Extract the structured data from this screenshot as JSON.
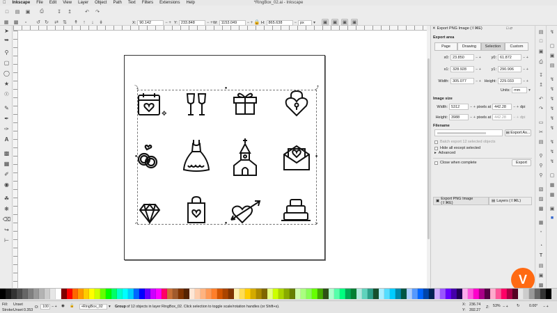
{
  "menubar": {
    "app": "Inkscape",
    "items": [
      "File",
      "Edit",
      "View",
      "Layer",
      "Object",
      "Path",
      "Text",
      "Filters",
      "Extensions",
      "Help"
    ],
    "window_title": "*RingBox_02.ai - Inkscape"
  },
  "toolbar": {
    "x": {
      "label": "X:",
      "value": "90.142"
    },
    "y": {
      "label": "Y:",
      "value": "233.848"
    },
    "w": {
      "label": "W:",
      "value": "1153.049"
    },
    "h": {
      "label": "H:",
      "value": "865.638"
    },
    "unit": "px"
  },
  "panel": {
    "title": "Export PNG Image (⇧⌘E)",
    "export_area_label": "Export area",
    "area_tabs": [
      "Page",
      "Drawing",
      "Selection",
      "Custom"
    ],
    "active_tab": "Selection",
    "x0": {
      "label": "x0:",
      "value": "23.850"
    },
    "y0": {
      "label": "y0:",
      "value": "61.872"
    },
    "x1": {
      "label": "x1:",
      "value": "328.928"
    },
    "y1": {
      "label": "y1:",
      "value": "290.906"
    },
    "width": {
      "label": "Width:",
      "value": "305.077"
    },
    "height": {
      "label": "Height:",
      "value": "229.033"
    },
    "units_label": "Units:",
    "units_value": "mm",
    "image_size_label": "Image size",
    "img_width": {
      "label": "Width:",
      "value": "5312",
      "at": "pixels at",
      "dpi": "442.28",
      "unit": "dpi"
    },
    "img_height": {
      "label": "Height:",
      "value": "3988",
      "at": "pixels at",
      "dpi": "442.28",
      "unit": "dpi"
    },
    "filename_label": "Filename",
    "export_as_label": "Export As...",
    "batch_label": "Batch export 12 selected objects",
    "hide_label": "Hide all except selected",
    "advanced_label": "Advanced",
    "close_label": "Close when complete",
    "export_label": "Export",
    "tab1": "Export PNG Image (⇧⌘E)",
    "tab2": "Layers (⇧⌘L)"
  },
  "status": {
    "fill_label": "Fill:",
    "fill_value": "Unset",
    "stroke_label": "Stroke:",
    "stroke_value": "Unset",
    "stroke_width": "0.353",
    "opacity_label": "O:",
    "opacity_value": "100",
    "layer": "•RingBox_02",
    "message_bold": "Group",
    "message": " of 12 objects in layer RingBox_02. Click selection to toggle scale/rotation handles (or Shift+s).",
    "cursor_x_label": "X:",
    "cursor_x": "236.74",
    "cursor_y_label": "Y:",
    "cursor_y": "392.27",
    "zoom_label": "Z:",
    "zoom": "53%",
    "rotation": "0.00°"
  },
  "palette_colors": [
    "#000000",
    "#1a1a1a",
    "#333333",
    "#4d4d4d",
    "#666666",
    "#808080",
    "#999999",
    "#b3b3b3",
    "#cccccc",
    "#e6e6e6",
    "#ffffff",
    "#800000",
    "#ff0000",
    "#ff6600",
    "#ff9900",
    "#ffcc00",
    "#ffff00",
    "#ccff00",
    "#66ff00",
    "#00ff00",
    "#00ff66",
    "#00ffcc",
    "#00ffff",
    "#00ccff",
    "#0066ff",
    "#0000ff",
    "#6600ff",
    "#cc00ff",
    "#ff00ff",
    "#ff0066",
    "#c87137",
    "#a05a2c",
    "#803300",
    "#552200",
    "#ffe6d5",
    "#ffccaa",
    "#ffb380",
    "#ff9955",
    "#ff7f2a",
    "#d45500",
    "#aa4400",
    "#803300",
    "#ffeeaa",
    "#ffdd55",
    "#ffcc00",
    "#d4aa00",
    "#aa8800",
    "#806600",
    "#e5ff80",
    "#ccff00",
    "#aad400",
    "#88aa00",
    "#668000",
    "#ccffaa",
    "#aaff80",
    "#88ff55",
    "#66ff00",
    "#44aa00",
    "#2d5016",
    "#aaffcc",
    "#55ffaa",
    "#00ff80",
    "#00aa55",
    "#008033",
    "#afe9dd",
    "#5fd3bc",
    "#2ca089",
    "#16502d",
    "#aaeeff",
    "#55ddff",
    "#00ccff",
    "#0088aa",
    "#005544",
    "#aaccff",
    "#5599ff",
    "#0066ff",
    "#0044aa",
    "#002255",
    "#ccaaff",
    "#9955ff",
    "#6600ff",
    "#4400aa",
    "#220055",
    "#ffaaee",
    "#ff55dd",
    "#ff00cc",
    "#aa0088",
    "#550044",
    "#ffaacc",
    "#ff5599",
    "#ff0066",
    "#aa0044",
    "#550022",
    "#e6e6e6",
    "#cccccc",
    "#999999",
    "#666666",
    "#333333",
    "#000000"
  ],
  "logo_glyph": "V"
}
